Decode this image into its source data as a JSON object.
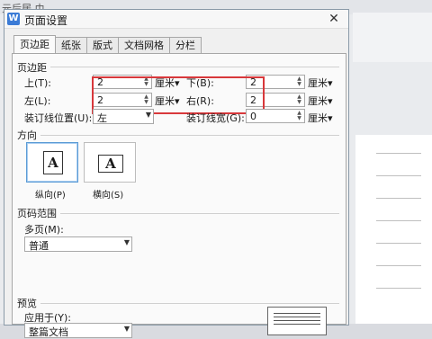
{
  "background": {
    "menu_text": "元后居    巾"
  },
  "dialog": {
    "title": "页面设置",
    "app_icon_letter": "W",
    "close_glyph": "✕",
    "tabs": [
      "页边距",
      "纸张",
      "版式",
      "文档网格",
      "分栏"
    ],
    "active_tab": "页边距",
    "margins": {
      "section_label": "页边距",
      "top_label": "上(T):",
      "top_value": "2",
      "bottom_label": "下(B):",
      "bottom_value": "2",
      "left_label": "左(L):",
      "left_value": "2",
      "right_label": "右(R):",
      "right_value": "2",
      "unit": "厘米",
      "gutter_pos_label": "装订线位置(U):",
      "gutter_pos_value": "左",
      "gutter_width_label": "装订线宽(G):",
      "gutter_width_value": "0"
    },
    "orientation": {
      "section_label": "方向",
      "portrait_label": "纵向(P)",
      "landscape_label": "横向(S)",
      "icon_glyph": "A",
      "selected": "portrait"
    },
    "page_range": {
      "section_label": "页码范围",
      "multiple_label": "多页(M):",
      "multiple_value": "普通"
    },
    "preview": {
      "section_label": "预览",
      "apply_to_label": "应用于(Y):",
      "apply_to_value": "整篇文档"
    },
    "colors": {
      "highlight": "#d8383b",
      "accent": "#3b7bd6"
    }
  }
}
